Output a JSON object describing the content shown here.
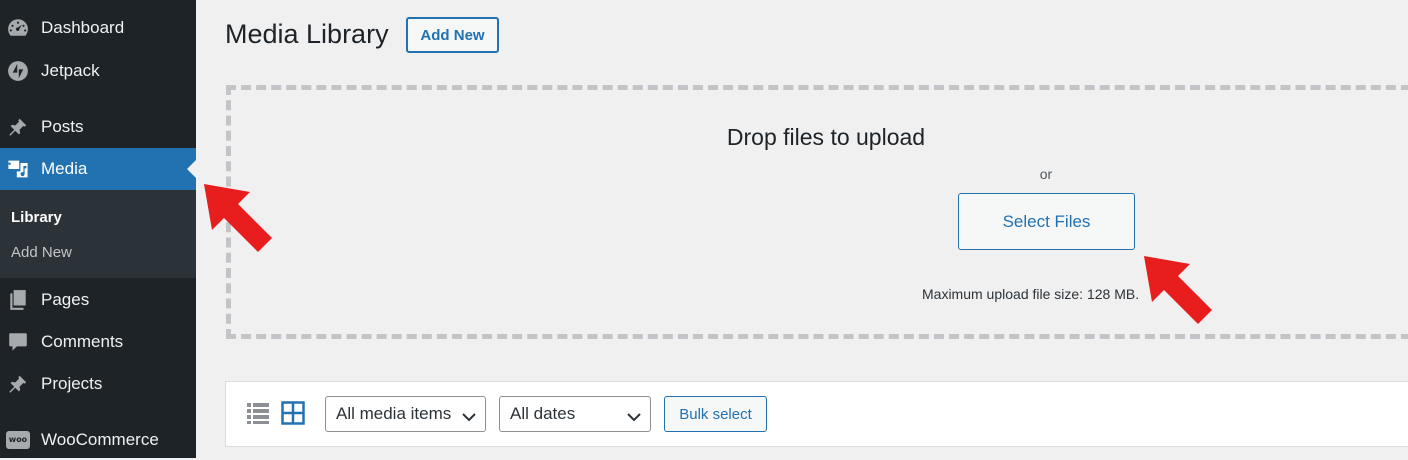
{
  "sidebar": {
    "items": [
      {
        "label": "Dashboard",
        "icon": "dashboard-icon"
      },
      {
        "label": "Jetpack",
        "icon": "jetpack-icon"
      },
      {
        "label": "Posts",
        "icon": "pushpin-icon"
      },
      {
        "label": "Media",
        "icon": "media-icon",
        "active": true
      },
      {
        "label": "Pages",
        "icon": "pages-icon"
      },
      {
        "label": "Comments",
        "icon": "comment-icon"
      },
      {
        "label": "Projects",
        "icon": "pushpin-icon"
      },
      {
        "label": "WooCommerce",
        "icon": "woocommerce-icon"
      }
    ],
    "submenu": [
      {
        "label": "Library",
        "current": true
      },
      {
        "label": "Add New"
      }
    ],
    "woo_badge": "woo"
  },
  "header": {
    "title": "Media Library",
    "add_new_label": "Add New"
  },
  "uploader": {
    "title": "Drop files to upload",
    "or_text": "or",
    "select_files_label": "Select Files",
    "max_size_text": "Maximum upload file size: 128 MB."
  },
  "toolbar": {
    "filter_type": "All media items",
    "filter_date": "All dates",
    "bulk_select_label": "Bulk select",
    "view_mode": "grid"
  },
  "colors": {
    "sidebar_bg": "#1d2327",
    "active_menu": "#2271b1",
    "accent": "#2271b1",
    "annotation_arrow": "#e81d1d"
  }
}
